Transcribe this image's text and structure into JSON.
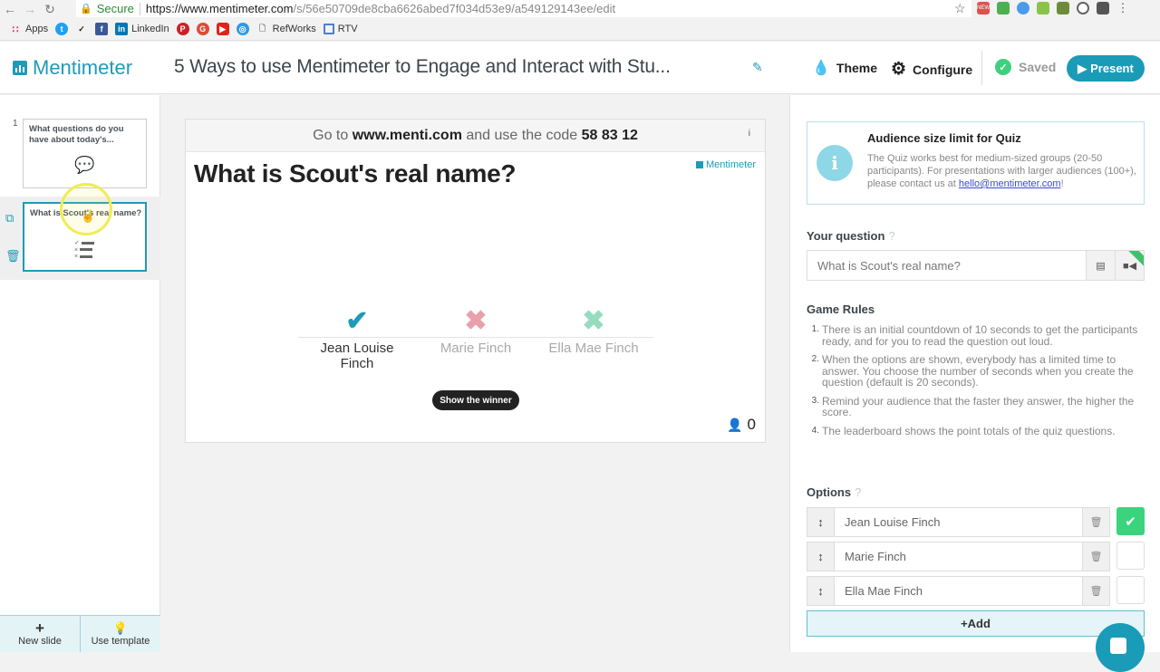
{
  "browser": {
    "secure_label": "Secure",
    "url_host": "https://www.mentimeter.com",
    "url_path": "/s/56e50709de8cba6626abed7f034d53e9/a549129143ee/edit",
    "extensions": [
      "new-badge-extension",
      "extension-green",
      "extension-blue",
      "extension-bookmark",
      "extension-clipboard",
      "extension-circle",
      "extension-dark",
      "more-menu"
    ],
    "bookmarks": [
      {
        "label": "Apps",
        "icon": "apps-grid-icon"
      },
      {
        "label": "",
        "icon": "twitter-icon"
      },
      {
        "label": "",
        "icon": "nike-icon"
      },
      {
        "label": "",
        "icon": "facebook-icon"
      },
      {
        "label": "LinkedIn",
        "icon": "linkedin-icon"
      },
      {
        "label": "",
        "icon": "pinterest-icon"
      },
      {
        "label": "",
        "icon": "google-plus-icon"
      },
      {
        "label": "",
        "icon": "youtube-icon"
      },
      {
        "label": "",
        "icon": "safari-icon"
      },
      {
        "label": "RefWorks",
        "icon": "page-icon"
      },
      {
        "label": "RTV",
        "icon": "rtv-icon"
      }
    ]
  },
  "header": {
    "logo": "Mentimeter",
    "title": "5 Ways to use Mentimeter to Engage and Interact with Stu...",
    "theme_label": "Theme",
    "configure_label": "Configure",
    "saved_label": "Saved",
    "present_label": "Present"
  },
  "sidebar": {
    "slides": [
      {
        "number": "1",
        "title": "What questions do you have about today's...",
        "icon": "chat-bubbles-icon"
      },
      {
        "number": "",
        "title": "What is Scout's real name?",
        "icon": "quiz-list-icon",
        "selected": true
      }
    ],
    "new_slide_label": "New slide",
    "use_template_label": "Use template"
  },
  "slide": {
    "code_prefix": "Go to",
    "code_site": "www.menti.com",
    "code_middle": "and use the code",
    "code": "58 83 12",
    "question": "What is Scout's real name?",
    "brand": "Mentimeter",
    "options": [
      {
        "label": "Jean Louise Finch",
        "correct": true,
        "color": "#1a9bb7"
      },
      {
        "label": "Marie Finch",
        "correct": false,
        "color": "#e9a0aa"
      },
      {
        "label": "Ella Mae Finch",
        "correct": false,
        "color": "#94dcbd"
      }
    ],
    "show_winner_label": "Show the winner",
    "response_count": "0"
  },
  "panel": {
    "notice": {
      "title": "Audience size limit for Quiz",
      "body": "The Quiz works best for medium-sized groups (20-50 participants). For presentations with larger audiences (100+), please contact us at ",
      "email": "hello@mentimeter.com",
      "suffix": "!"
    },
    "question_label": "Your question",
    "question_value": "What is Scout's real name?",
    "game_rules_label": "Game Rules",
    "rules": [
      {
        "n": "1.",
        "text": "There is an initial countdown of 10 seconds to get the participants ready, and for you to read the question out loud."
      },
      {
        "n": "2.",
        "text": "When the options are shown, everybody has a limited time to answer. You choose the number of seconds when you create the question (default is 20 seconds)."
      },
      {
        "n": "3.",
        "text": "Remind your audience that the faster they answer, the higher the score."
      },
      {
        "n": "4.",
        "text": "The leaderboard shows the point totals of the quiz questions."
      }
    ],
    "options_label": "Options",
    "options": [
      {
        "value": "Jean Louise Finch",
        "correct": true
      },
      {
        "value": "Marie Finch",
        "correct": false
      },
      {
        "value": "Ella Mae Finch",
        "correct": false
      }
    ],
    "add_label": "+Add"
  },
  "colors": {
    "brand": "#1e9bb8",
    "saved": "#3fd07d",
    "correct": "#3ad47e"
  }
}
